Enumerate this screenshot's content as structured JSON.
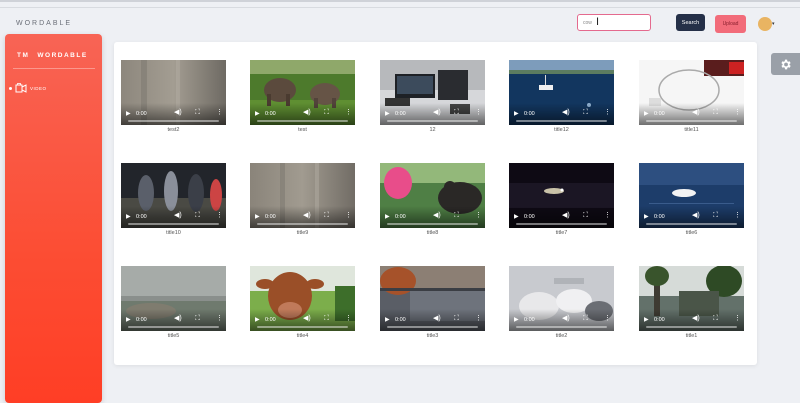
{
  "app_title": "WORDABLE",
  "search": {
    "value": "cow",
    "button_label": "Search"
  },
  "upload_label": "Upload",
  "sidebar": {
    "brand": "WORDABLE",
    "brand_logo": "TM",
    "items": [
      {
        "label": "VIDEO",
        "icon": "video-icon"
      }
    ]
  },
  "video_controls": {
    "time": "0:00"
  },
  "videos": [
    {
      "title": "test2"
    },
    {
      "title": "test"
    },
    {
      "title": "12"
    },
    {
      "title": "title12"
    },
    {
      "title": "title11"
    },
    {
      "title": "title10"
    },
    {
      "title": "title9"
    },
    {
      "title": "title8"
    },
    {
      "title": "title7"
    },
    {
      "title": "title6"
    },
    {
      "title": "title5"
    },
    {
      "title": "title4"
    },
    {
      "title": "title3"
    },
    {
      "title": "title2"
    },
    {
      "title": "title1"
    }
  ],
  "colors": {
    "sidebar_top": "#f86455",
    "sidebar_bottom": "#ff3e25",
    "search_button": "#253048",
    "upload_button": "#f26c7a",
    "search_border": "#e46a8e"
  }
}
